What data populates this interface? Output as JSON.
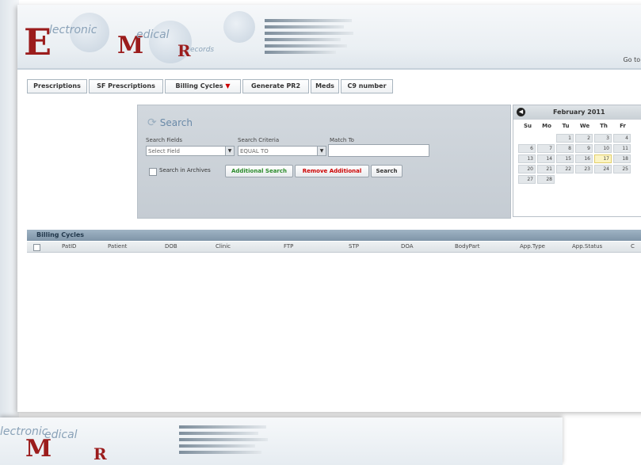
{
  "header": {
    "logo_e": "E",
    "logo_word1": "lectronic",
    "logo_m": "M",
    "logo_word2": "edical",
    "logo_r": "R",
    "logo_word3": "ecords",
    "goto": "Go to st"
  },
  "tabs": [
    {
      "label": "Prescriptions"
    },
    {
      "label": "SF Prescriptions"
    },
    {
      "label": "Billing Cycles"
    },
    {
      "label": "Generate PR2"
    },
    {
      "label": "Meds"
    },
    {
      "label": "C9 number"
    }
  ],
  "search": {
    "title": "Search",
    "fields_label": "Search Fields",
    "fields_value": "Select Field",
    "criteria_label": "Search Criteria",
    "criteria_value": "EQUAL TO",
    "match_label": "Match To",
    "match_value": "",
    "archives_label": "Search in Archives",
    "additional_label": "Additional Search",
    "remove_label": "Remove Additional",
    "search_label": "Search"
  },
  "calendar": {
    "title": "February 2011",
    "days": [
      "Su",
      "Mo",
      "Tu",
      "We",
      "Th",
      "Fr"
    ],
    "rows": [
      [
        "",
        "",
        "1",
        "2",
        "3",
        "4"
      ],
      [
        "6",
        "7",
        "8",
        "9",
        "10",
        "11"
      ],
      [
        "13",
        "14",
        "15",
        "16",
        "17",
        "18"
      ],
      [
        "20",
        "21",
        "22",
        "23",
        "24",
        "25"
      ],
      [
        "27",
        "28",
        "",
        "",
        "",
        ""
      ]
    ],
    "today": "17"
  },
  "grid": {
    "title": "Billing Cycles",
    "columns": [
      "PatID",
      "Patient",
      "DOB",
      "Clinic",
      "FTP",
      "STP",
      "DOA",
      "BodyPart",
      "App.Type",
      "App.Status",
      "C"
    ]
  },
  "colors": {
    "logo_red": "#9b1c1c",
    "grid_header": "#8fa4b6",
    "remove_button_text": "#cc0000",
    "additional_button_text": "#2a8a2a"
  }
}
